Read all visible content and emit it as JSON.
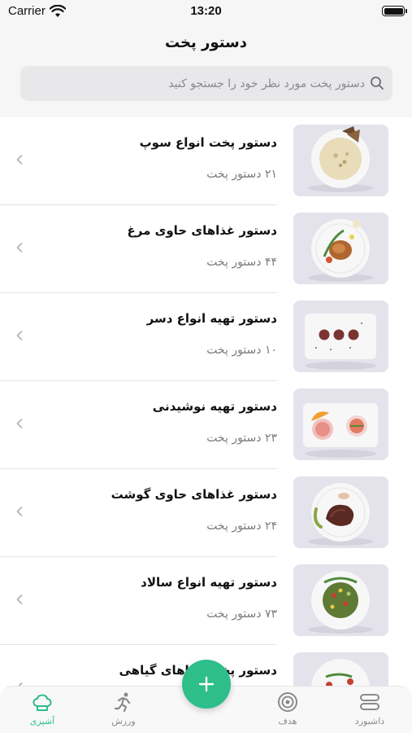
{
  "status_bar": {
    "carrier": "Carrier",
    "time": "13:20"
  },
  "header": {
    "title": "دستور پخت",
    "search_placeholder": "دستور پخت مورد نظر خود را جستجو کنید"
  },
  "categories": [
    {
      "title": "دستور پخت انواع سوپ",
      "count": "۲۱ دستور پخت",
      "image": "soup-plate"
    },
    {
      "title": "دستور غذاهای حاوی مرغ",
      "count": "۴۴ دستور پخت",
      "image": "chicken-plate"
    },
    {
      "title": "دستور تهیه انواع دسر",
      "count": "۱۰ دستور پخت",
      "image": "dessert-tray"
    },
    {
      "title": "دستور تهیه نوشیدنی",
      "count": "۲۳ دستور پخت",
      "image": "drink-tray"
    },
    {
      "title": "دستور غذاهای حاوی گوشت",
      "count": "۲۴ دستور پخت",
      "image": "steak-plate"
    },
    {
      "title": "دستور تهیه انواع سالاد",
      "count": "۷۳ دستور پخت",
      "image": "salad-plate"
    },
    {
      "title": "دستور پخت غذاهای گیاهی",
      "count": "",
      "image": "vegetable-plate"
    }
  ],
  "tabbar": {
    "tabs": [
      {
        "label": "آشپزی",
        "icon": "chef-hat-icon",
        "active": true
      },
      {
        "label": "ورزش",
        "icon": "running-icon",
        "active": false
      },
      {
        "label": "هدف",
        "icon": "target-icon",
        "active": false
      },
      {
        "label": "داشبورد",
        "icon": "dashboard-icon",
        "active": false
      }
    ],
    "fab_icon": "plus-icon"
  },
  "colors": {
    "accent": "#2dbe8a",
    "header_bg": "#f6f6f7",
    "search_bg": "#e8e8ea"
  }
}
